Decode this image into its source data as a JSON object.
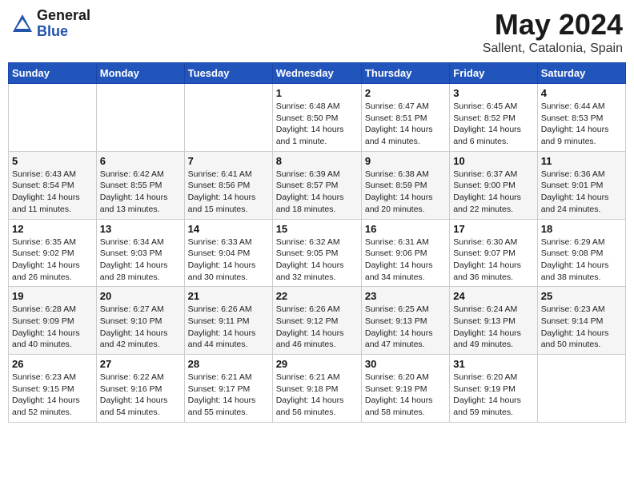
{
  "logo": {
    "general": "General",
    "blue": "Blue"
  },
  "title": "May 2024",
  "location": "Sallent, Catalonia, Spain",
  "days_of_week": [
    "Sunday",
    "Monday",
    "Tuesday",
    "Wednesday",
    "Thursday",
    "Friday",
    "Saturday"
  ],
  "weeks": [
    [
      {
        "day": "",
        "info": ""
      },
      {
        "day": "",
        "info": ""
      },
      {
        "day": "",
        "info": ""
      },
      {
        "day": "1",
        "info": "Sunrise: 6:48 AM\nSunset: 8:50 PM\nDaylight: 14 hours\nand 1 minute."
      },
      {
        "day": "2",
        "info": "Sunrise: 6:47 AM\nSunset: 8:51 PM\nDaylight: 14 hours\nand 4 minutes."
      },
      {
        "day": "3",
        "info": "Sunrise: 6:45 AM\nSunset: 8:52 PM\nDaylight: 14 hours\nand 6 minutes."
      },
      {
        "day": "4",
        "info": "Sunrise: 6:44 AM\nSunset: 8:53 PM\nDaylight: 14 hours\nand 9 minutes."
      }
    ],
    [
      {
        "day": "5",
        "info": "Sunrise: 6:43 AM\nSunset: 8:54 PM\nDaylight: 14 hours\nand 11 minutes."
      },
      {
        "day": "6",
        "info": "Sunrise: 6:42 AM\nSunset: 8:55 PM\nDaylight: 14 hours\nand 13 minutes."
      },
      {
        "day": "7",
        "info": "Sunrise: 6:41 AM\nSunset: 8:56 PM\nDaylight: 14 hours\nand 15 minutes."
      },
      {
        "day": "8",
        "info": "Sunrise: 6:39 AM\nSunset: 8:57 PM\nDaylight: 14 hours\nand 18 minutes."
      },
      {
        "day": "9",
        "info": "Sunrise: 6:38 AM\nSunset: 8:59 PM\nDaylight: 14 hours\nand 20 minutes."
      },
      {
        "day": "10",
        "info": "Sunrise: 6:37 AM\nSunset: 9:00 PM\nDaylight: 14 hours\nand 22 minutes."
      },
      {
        "day": "11",
        "info": "Sunrise: 6:36 AM\nSunset: 9:01 PM\nDaylight: 14 hours\nand 24 minutes."
      }
    ],
    [
      {
        "day": "12",
        "info": "Sunrise: 6:35 AM\nSunset: 9:02 PM\nDaylight: 14 hours\nand 26 minutes."
      },
      {
        "day": "13",
        "info": "Sunrise: 6:34 AM\nSunset: 9:03 PM\nDaylight: 14 hours\nand 28 minutes."
      },
      {
        "day": "14",
        "info": "Sunrise: 6:33 AM\nSunset: 9:04 PM\nDaylight: 14 hours\nand 30 minutes."
      },
      {
        "day": "15",
        "info": "Sunrise: 6:32 AM\nSunset: 9:05 PM\nDaylight: 14 hours\nand 32 minutes."
      },
      {
        "day": "16",
        "info": "Sunrise: 6:31 AM\nSunset: 9:06 PM\nDaylight: 14 hours\nand 34 minutes."
      },
      {
        "day": "17",
        "info": "Sunrise: 6:30 AM\nSunset: 9:07 PM\nDaylight: 14 hours\nand 36 minutes."
      },
      {
        "day": "18",
        "info": "Sunrise: 6:29 AM\nSunset: 9:08 PM\nDaylight: 14 hours\nand 38 minutes."
      }
    ],
    [
      {
        "day": "19",
        "info": "Sunrise: 6:28 AM\nSunset: 9:09 PM\nDaylight: 14 hours\nand 40 minutes."
      },
      {
        "day": "20",
        "info": "Sunrise: 6:27 AM\nSunset: 9:10 PM\nDaylight: 14 hours\nand 42 minutes."
      },
      {
        "day": "21",
        "info": "Sunrise: 6:26 AM\nSunset: 9:11 PM\nDaylight: 14 hours\nand 44 minutes."
      },
      {
        "day": "22",
        "info": "Sunrise: 6:26 AM\nSunset: 9:12 PM\nDaylight: 14 hours\nand 46 minutes."
      },
      {
        "day": "23",
        "info": "Sunrise: 6:25 AM\nSunset: 9:13 PM\nDaylight: 14 hours\nand 47 minutes."
      },
      {
        "day": "24",
        "info": "Sunrise: 6:24 AM\nSunset: 9:13 PM\nDaylight: 14 hours\nand 49 minutes."
      },
      {
        "day": "25",
        "info": "Sunrise: 6:23 AM\nSunset: 9:14 PM\nDaylight: 14 hours\nand 50 minutes."
      }
    ],
    [
      {
        "day": "26",
        "info": "Sunrise: 6:23 AM\nSunset: 9:15 PM\nDaylight: 14 hours\nand 52 minutes."
      },
      {
        "day": "27",
        "info": "Sunrise: 6:22 AM\nSunset: 9:16 PM\nDaylight: 14 hours\nand 54 minutes."
      },
      {
        "day": "28",
        "info": "Sunrise: 6:21 AM\nSunset: 9:17 PM\nDaylight: 14 hours\nand 55 minutes."
      },
      {
        "day": "29",
        "info": "Sunrise: 6:21 AM\nSunset: 9:18 PM\nDaylight: 14 hours\nand 56 minutes."
      },
      {
        "day": "30",
        "info": "Sunrise: 6:20 AM\nSunset: 9:19 PM\nDaylight: 14 hours\nand 58 minutes."
      },
      {
        "day": "31",
        "info": "Sunrise: 6:20 AM\nSunset: 9:19 PM\nDaylight: 14 hours\nand 59 minutes."
      },
      {
        "day": "",
        "info": ""
      }
    ]
  ]
}
